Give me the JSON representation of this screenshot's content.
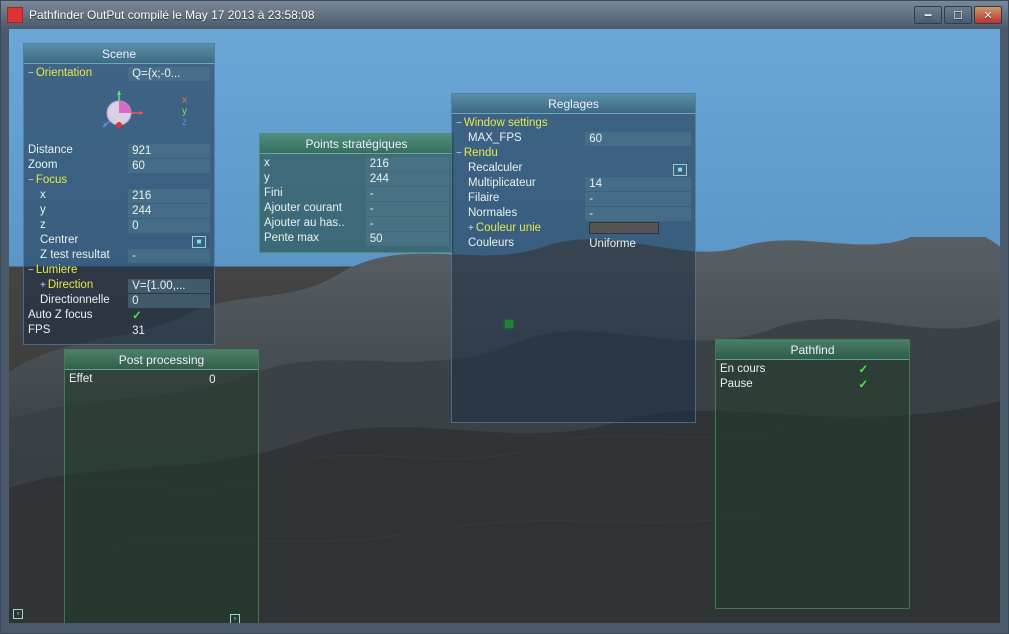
{
  "window": {
    "title": "Pathfinder OutPut compilé le May 17 2013 à 23:58:08"
  },
  "panels": {
    "scene": {
      "title": "Scene",
      "orientation": {
        "label": "Orientation",
        "q": "Q={x;-0..."
      },
      "axes": {
        "x": "x",
        "y": "y",
        "z": "z"
      },
      "distance": {
        "label": "Distance",
        "value": "921"
      },
      "zoom": {
        "label": "Zoom",
        "value": "60"
      },
      "focus": {
        "label": "Focus",
        "x": {
          "label": "x",
          "value": "216"
        },
        "y": {
          "label": "y",
          "value": "244"
        },
        "z": {
          "label": "z",
          "value": "0"
        },
        "center": {
          "label": "Centrer"
        },
        "ztest": {
          "label": "Z test resultat",
          "value": "-"
        }
      },
      "lumiere": {
        "label": "Lumiere",
        "direction": {
          "label": "Direction",
          "value": "V={1.00,..."
        },
        "directionnelle": {
          "label": "Directionnelle",
          "value": "0"
        }
      },
      "autoz": {
        "label": "Auto Z focus"
      },
      "fps": {
        "label": "FPS",
        "value": "31"
      }
    },
    "points": {
      "title": "Points stratégiques",
      "x": {
        "label": "x",
        "value": "216"
      },
      "y": {
        "label": "y",
        "value": "244"
      },
      "fini": {
        "label": "Fini",
        "value": "-"
      },
      "ajouter_courant": {
        "label": "Ajouter courant",
        "value": "-"
      },
      "ajouter_hasard": {
        "label": "Ajouter au has..",
        "value": "-"
      },
      "pente": {
        "label": "Pente max",
        "value": "50"
      }
    },
    "reglages": {
      "title": "Reglages",
      "winset": {
        "label": "Window settings"
      },
      "maxfps": {
        "label": "MAX_FPS",
        "value": "60"
      },
      "rendu": {
        "label": "Rendu",
        "recalculer": {
          "label": "Recalculer"
        },
        "multiplicateur": {
          "label": "Multiplicateur",
          "value": "14"
        },
        "filaire": {
          "label": "Filaire",
          "value": "-"
        },
        "normales": {
          "label": "Normales",
          "value": "-"
        },
        "couleur_unie": {
          "label": "Couleur unie"
        },
        "couleurs": {
          "label": "Couleurs",
          "value": "Uniforme"
        }
      }
    },
    "postproc": {
      "title": "Post processing",
      "effet": {
        "label": "Effet",
        "value": "0"
      }
    },
    "pathfind": {
      "title": "Pathfind",
      "encours": {
        "label": "En cours"
      },
      "pause": {
        "label": "Pause"
      }
    }
  }
}
